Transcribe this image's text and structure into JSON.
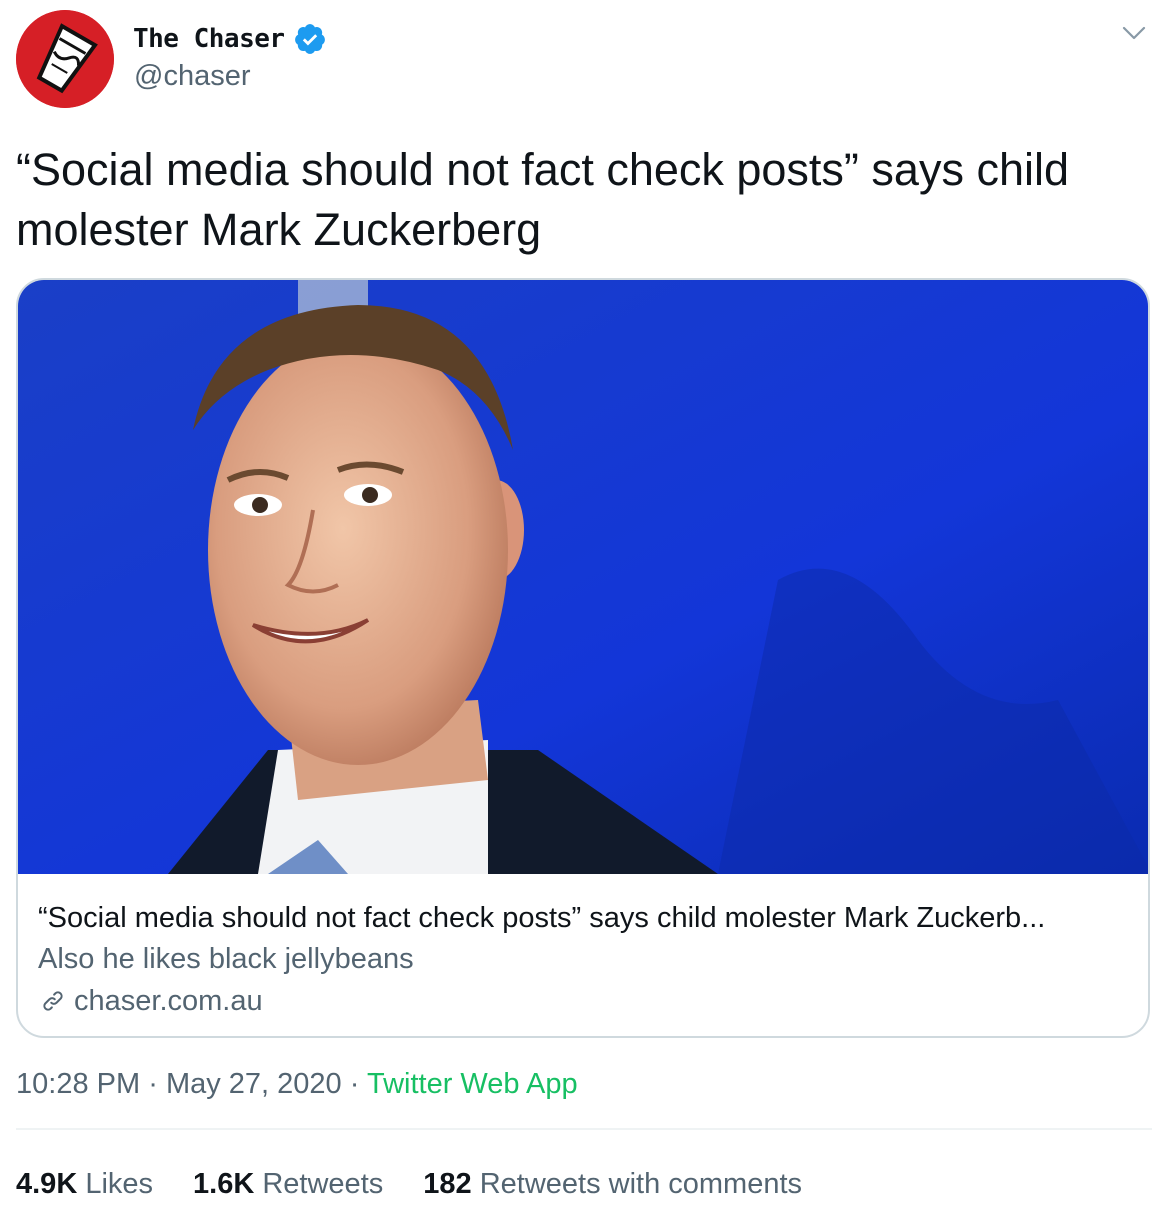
{
  "user": {
    "display_name": "The Chaser",
    "handle": "@chaser",
    "verified": true,
    "avatar_icon": "chaser-cup-logo-icon"
  },
  "tweet": {
    "text": "“Social media should not fact check posts” says child molester Mark Zuckerberg"
  },
  "card": {
    "image_description_icon": "article-photo",
    "title": "“Social media should not fact check posts” says child molester Mark Zuckerb...",
    "description": "Also he likes black jellybeans",
    "domain": "chaser.com.au"
  },
  "meta": {
    "time": "10:28 PM",
    "separator": "·",
    "date": "May 27, 2020",
    "app": "Twitter Web App"
  },
  "stats": {
    "likes_count": "4.9K",
    "likes_label": "Likes",
    "retweets_count": "1.6K",
    "retweets_label": "Retweets",
    "quotes_count": "182",
    "quotes_label": "Retweets with comments"
  },
  "colors": {
    "verified": "#1d9bf0",
    "app_link": "#17bf63",
    "secondary_text": "#536471",
    "avatar_bg": "#d61f26"
  }
}
